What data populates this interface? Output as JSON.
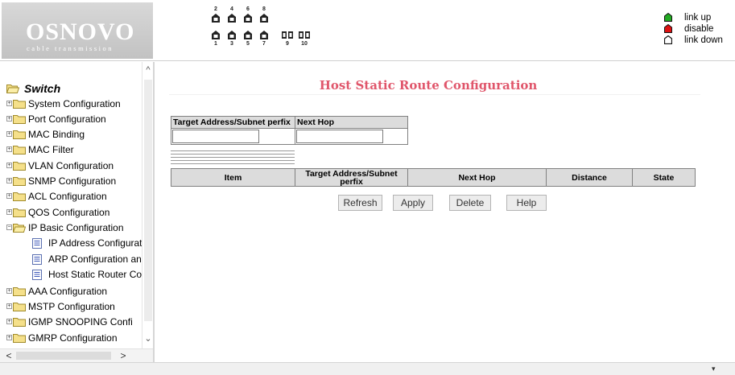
{
  "brand": {
    "name": "OSNOVO",
    "tagline": "cable transmission"
  },
  "ports": {
    "top_numbers": [
      "2",
      "4",
      "6",
      "8"
    ],
    "bottom_numbers": [
      "1",
      "3",
      "5",
      "7"
    ],
    "sfp_numbers": [
      "9",
      "10"
    ]
  },
  "legend": {
    "items": [
      {
        "label": "link up",
        "color": "#22aa22"
      },
      {
        "label": "disable",
        "color": "#dd1111"
      },
      {
        "label": "link down",
        "color": "#ffffff"
      }
    ]
  },
  "sidebar": {
    "root": "Switch",
    "items": [
      {
        "label": "System Configuration",
        "expanded": false
      },
      {
        "label": "Port Configuration",
        "expanded": false
      },
      {
        "label": "MAC Binding",
        "expanded": false
      },
      {
        "label": "MAC Filter",
        "expanded": false
      },
      {
        "label": "VLAN Configuration",
        "expanded": false
      },
      {
        "label": "SNMP Configuration",
        "expanded": false
      },
      {
        "label": "ACL Configuration",
        "expanded": false
      },
      {
        "label": "QOS Configuration",
        "expanded": false
      },
      {
        "label": "IP Basic Configuration",
        "expanded": true
      },
      {
        "label": "AAA Configuration",
        "expanded": false
      },
      {
        "label": "MSTP Configuration",
        "expanded": false
      },
      {
        "label": "IGMP SNOOPING Confi",
        "expanded": false
      },
      {
        "label": "GMRP Configuration",
        "expanded": false
      }
    ],
    "children": [
      {
        "label": "IP Address Configurat"
      },
      {
        "label": "ARP Configuration an"
      },
      {
        "label": "Host Static Router Co"
      }
    ],
    "scroll_up": "^",
    "scroll_down": "⌄",
    "scroll_left": "<",
    "scroll_right": ">"
  },
  "main": {
    "title": "Host Static Route Configuration",
    "form": {
      "target_label": "Target Address/Subnet perfix",
      "nexthop_label": "Next Hop",
      "target_value": "",
      "nexthop_value": ""
    },
    "table": {
      "columns": [
        "Item",
        "Target Address/Subnet perfix",
        "Next Hop",
        "Distance",
        "State"
      ],
      "rows": []
    },
    "buttons": {
      "refresh": "Refresh",
      "apply": "Apply",
      "delete": "Delete",
      "help": "Help"
    }
  },
  "statusbar": {
    "arrow": "▾"
  }
}
